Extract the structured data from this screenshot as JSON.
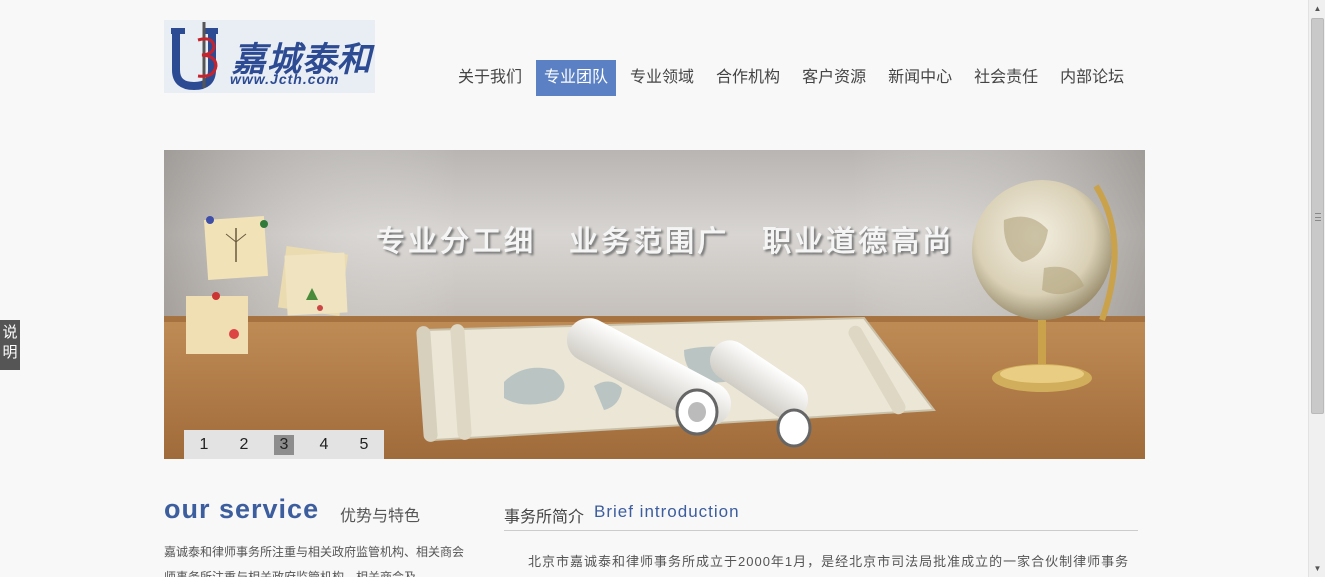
{
  "logo": {
    "name_cn": "嘉城泰和",
    "url": "www.Jcth.com"
  },
  "nav": {
    "items": [
      {
        "label": "关于我们"
      },
      {
        "label": "专业团队"
      },
      {
        "label": "专业领域"
      },
      {
        "label": "合作机构"
      },
      {
        "label": "客户资源"
      },
      {
        "label": "新闻中心"
      },
      {
        "label": "社会责任"
      },
      {
        "label": "内部论坛"
      }
    ],
    "active": "专业团队"
  },
  "banner": {
    "slogan": "专业分工细 业务范围广 职业道德高尚",
    "slides": [
      "1",
      "2",
      "3",
      "4",
      "5"
    ],
    "active_slide": "3"
  },
  "side_tab": {
    "line1": "说",
    "line2": "明"
  },
  "service": {
    "title": "our service",
    "subtitle": "优势与特色",
    "text": "嘉诚泰和律师事务所注重与相关政府监管机构、相关商会 师事务所注重与相关政府监管机构、相关商会及"
  },
  "intro": {
    "title_cn": "事务所简介",
    "title_en": "Brief introduction",
    "text": "北京市嘉诚泰和律师事务所成立于2000年1月，是经北京市司法局批准成立的一家合伙制律师事务"
  },
  "colors": {
    "accent": "#5b80c3",
    "brand": "#2d4b92",
    "heading": "#3c5d9e"
  },
  "icons": {
    "scroll_up": "arrow-up-icon",
    "scroll_down": "arrow-down-icon"
  }
}
